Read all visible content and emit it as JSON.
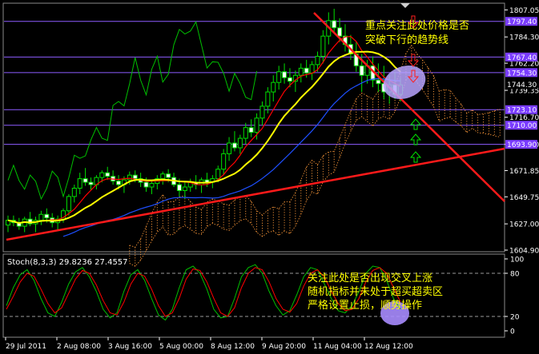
{
  "chart_data": [
    {
      "type": "candlestick",
      "panel": "price",
      "price_axis": {
        "ylim": [
          1604.9,
          1810
        ],
        "ticks": [
          1807.05,
          1784.3,
          1762.2,
          1739.35,
          1716.7,
          1693.9,
          1671.85,
          1649.75,
          1627.0,
          1604.9
        ]
      },
      "price_tags": [
        {
          "label": "1797.40",
          "value": 1797.4
        },
        {
          "label": "1767.40",
          "value": 1767.4
        },
        {
          "label": "1754.30",
          "value": 1754.3
        },
        {
          "label": "1744.30",
          "value": 1744.3,
          "current": true
        },
        {
          "label": "1723.10",
          "value": 1723.1
        },
        {
          "label": "1710.00",
          "value": 1710.0
        },
        {
          "label": "1693.90",
          "value": 1693.9
        }
      ],
      "horizontal_levels": [
        1797.4,
        1767.4,
        1754.3,
        1723.1,
        1710.0,
        1693.9
      ],
      "candles": [
        [
          1626,
          1634,
          1620,
          1630
        ],
        [
          1630,
          1634,
          1625,
          1628
        ],
        [
          1628,
          1632,
          1622,
          1625
        ],
        [
          1625,
          1633,
          1620,
          1631
        ],
        [
          1631,
          1637,
          1625,
          1627
        ],
        [
          1627,
          1633,
          1620,
          1630
        ],
        [
          1630,
          1638,
          1626,
          1635
        ],
        [
          1635,
          1640,
          1628,
          1632
        ],
        [
          1632,
          1636,
          1624,
          1628
        ],
        [
          1628,
          1634,
          1622,
          1631
        ],
        [
          1631,
          1640,
          1628,
          1638
        ],
        [
          1638,
          1652,
          1634,
          1650
        ],
        [
          1650,
          1660,
          1645,
          1657
        ],
        [
          1657,
          1670,
          1652,
          1665
        ],
        [
          1665,
          1674,
          1659,
          1662
        ],
        [
          1662,
          1666,
          1655,
          1660
        ],
        [
          1660,
          1668,
          1656,
          1666
        ],
        [
          1666,
          1672,
          1662,
          1670
        ],
        [
          1670,
          1675,
          1664,
          1667
        ],
        [
          1667,
          1672,
          1660,
          1663
        ],
        [
          1663,
          1668,
          1656,
          1660
        ],
        [
          1660,
          1667,
          1653,
          1664
        ],
        [
          1664,
          1671,
          1660,
          1668
        ],
        [
          1668,
          1672,
          1662,
          1665
        ],
        [
          1665,
          1670,
          1658,
          1662
        ],
        [
          1662,
          1666,
          1654,
          1658
        ],
        [
          1658,
          1664,
          1652,
          1661
        ],
        [
          1661,
          1668,
          1656,
          1665
        ],
        [
          1665,
          1671,
          1660,
          1669
        ],
        [
          1669,
          1673,
          1662,
          1666
        ],
        [
          1666,
          1670,
          1658,
          1660
        ],
        [
          1660,
          1665,
          1650,
          1655
        ],
        [
          1655,
          1662,
          1648,
          1658
        ],
        [
          1658,
          1665,
          1654,
          1662
        ],
        [
          1662,
          1668,
          1656,
          1660
        ],
        [
          1660,
          1666,
          1653,
          1664
        ],
        [
          1664,
          1670,
          1658,
          1662
        ],
        [
          1662,
          1668,
          1657,
          1665
        ],
        [
          1665,
          1676,
          1662,
          1673
        ],
        [
          1673,
          1690,
          1668,
          1686
        ],
        [
          1686,
          1700,
          1680,
          1695
        ],
        [
          1695,
          1705,
          1688,
          1691
        ],
        [
          1691,
          1702,
          1686,
          1699
        ],
        [
          1699,
          1712,
          1694,
          1708
        ],
        [
          1708,
          1715,
          1700,
          1704
        ],
        [
          1704,
          1720,
          1698,
          1716
        ],
        [
          1716,
          1730,
          1710,
          1726
        ],
        [
          1726,
          1742,
          1720,
          1738
        ],
        [
          1738,
          1752,
          1730,
          1746
        ],
        [
          1746,
          1760,
          1740,
          1755
        ],
        [
          1755,
          1762,
          1745,
          1750
        ],
        [
          1750,
          1758,
          1742,
          1747
        ],
        [
          1747,
          1756,
          1738,
          1752
        ],
        [
          1752,
          1762,
          1746,
          1758
        ],
        [
          1758,
          1765,
          1750,
          1754
        ],
        [
          1754,
          1764,
          1748,
          1761
        ],
        [
          1761,
          1772,
          1755,
          1768
        ],
        [
          1768,
          1790,
          1762,
          1785
        ],
        [
          1785,
          1805,
          1778,
          1798
        ],
        [
          1798,
          1808,
          1788,
          1792
        ],
        [
          1792,
          1800,
          1780,
          1785
        ],
        [
          1785,
          1795,
          1772,
          1778
        ],
        [
          1778,
          1786,
          1765,
          1770
        ],
        [
          1770,
          1780,
          1755,
          1760
        ],
        [
          1760,
          1770,
          1738,
          1752
        ],
        [
          1752,
          1765,
          1745,
          1760
        ],
        [
          1760,
          1768,
          1742,
          1748
        ],
        [
          1748,
          1762,
          1738,
          1745
        ],
        [
          1745,
          1760,
          1732,
          1738
        ],
        [
          1738,
          1752,
          1728,
          1744
        ],
        [
          1744,
          1755,
          1732,
          1736
        ],
        [
          1736,
          1750,
          1730,
          1744
        ]
      ],
      "overlays": [
        {
          "color": "#ffff00",
          "kind": "moving-average"
        },
        {
          "color": "#ff0000",
          "kind": "moving-average"
        },
        {
          "color": "#1e4fff",
          "kind": "moving-average"
        },
        {
          "color": "#00c000",
          "kind": "lagging-line"
        },
        {
          "color": "#ff9a3a",
          "kind": "cloud"
        }
      ],
      "annotations": [
        "重点关注此处价格是否",
        "突破下行的趋势线"
      ]
    },
    {
      "type": "line",
      "panel": "stochastic",
      "title": "Stoch(8,3,3) 29.8236 27.4557",
      "ylim": [
        0,
        100
      ],
      "ticks": [
        "100",
        "80",
        "20",
        "0"
      ],
      "levels": [
        80,
        20
      ],
      "x": [
        "29 Jul 2011",
        "2 Aug 08:00",
        "3 Aug 16:00",
        "5 Aug 00:00",
        "8 Aug 12:00",
        "9 Aug 20:00",
        "11 Aug 04:00",
        "12 Aug 12:00"
      ],
      "series": [
        {
          "color": "#00c000",
          "values": [
            35,
            60,
            78,
            85,
            70,
            45,
            25,
            20,
            40,
            65,
            82,
            88,
            75,
            55,
            30,
            18,
            25,
            55,
            78,
            85,
            70,
            45,
            22,
            15,
            30,
            60,
            85,
            90,
            80,
            58,
            30,
            18,
            20,
            45,
            75,
            88,
            92,
            80,
            55,
            35,
            22,
            28,
            50,
            75,
            88,
            85,
            65,
            45,
            28,
            25,
            35,
            55,
            80,
            90,
            88,
            70,
            45,
            30
          ]
        },
        {
          "color": "#ff0000",
          "values": [
            30,
            48,
            68,
            80,
            76,
            58,
            38,
            25,
            32,
            52,
            72,
            84,
            80,
            64,
            42,
            25,
            22,
            40,
            65,
            80,
            76,
            58,
            35,
            20,
            25,
            45,
            72,
            86,
            84,
            68,
            45,
            25,
            20,
            32,
            60,
            80,
            88,
            85,
            68,
            45,
            30,
            26,
            38,
            62,
            80,
            85,
            75,
            55,
            38,
            28,
            30,
            45,
            68,
            84,
            88,
            80,
            60,
            40
          ]
        }
      ],
      "annotations": [
        "关注此处是否出现交叉上涨",
        "随机指标并未处于超买超卖区",
        "严格设置止损，顺势操作"
      ]
    }
  ]
}
